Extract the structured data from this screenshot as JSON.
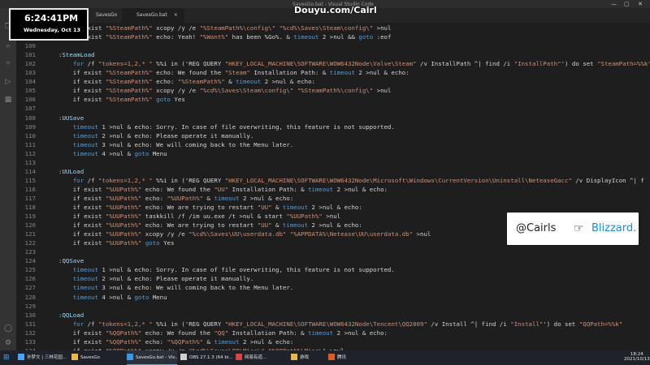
{
  "window": {
    "title": "SavesGo.bat - Visual Studio Code",
    "controls": [
      "—",
      "▢",
      "✕"
    ]
  },
  "tabs": [
    {
      "label": "SavesGo",
      "active": false
    },
    {
      "label": "SavesGo.bat",
      "active": true
    }
  ],
  "clock": {
    "time": "6:24:41PM",
    "date": "Wednesday, Oct 13"
  },
  "watermark": "Douyu.com/Cairl",
  "popup": {
    "handle": "@Cairls",
    "hand_icon": "pointing-hand-icon",
    "brand": "Blizzard."
  },
  "activity_bar": [
    "files-icon",
    "search-icon",
    "source-control-icon",
    "run-icon",
    "extensions-icon",
    "account-icon",
    "settings-icon"
  ],
  "code_lines": [
    {
      "num": "",
      "segments": [
        {
          "t": "plain",
          "s": "    if exist "
        },
        {
          "t": "str",
          "s": "\"%SteamPath%\""
        },
        {
          "t": "plain",
          "s": " xcopy /y /e "
        },
        {
          "t": "str",
          "s": "\"%SteamPath%\\config\\\""
        },
        {
          "t": "plain",
          "s": " "
        },
        {
          "t": "str",
          "s": "\"%cd%\\Saves\\Steam\\config\\\""
        },
        {
          "t": "plain",
          "s": " >nul"
        }
      ]
    },
    {
      "num": "",
      "segments": [
        {
          "t": "plain",
          "s": "    if exist "
        },
        {
          "t": "str",
          "s": "\"%SteamPath%\""
        },
        {
          "t": "plain",
          "s": " echo: Yeah! "
        },
        {
          "t": "str",
          "s": "\"%Want%\""
        },
        {
          "t": "plain",
          "s": " has been %Go%. & "
        },
        {
          "t": "kw",
          "s": "timeout"
        },
        {
          "t": "plain",
          "s": " 2 >nul && "
        },
        {
          "t": "kw",
          "s": "goto"
        },
        {
          "t": "plain",
          "s": " :eof"
        }
      ]
    },
    {
      "num": "100",
      "segments": []
    },
    {
      "num": "101",
      "segments": [
        {
          "t": "lbl",
          "s": ":SteamLoad"
        }
      ]
    },
    {
      "num": "102",
      "segments": [
        {
          "t": "plain",
          "s": "    "
        },
        {
          "t": "kw",
          "s": "for"
        },
        {
          "t": "plain",
          "s": " /f "
        },
        {
          "t": "str",
          "s": "\"tokens=1,2,* \""
        },
        {
          "t": "plain",
          "s": " %%i in ('REG QUERY "
        },
        {
          "t": "str",
          "s": "\"HKEY_LOCAL_MACHINE\\SOFTWARE\\WOW6432Node\\Valve\\Steam\""
        },
        {
          "t": "plain",
          "s": " /v InstallPath ^| find /i "
        },
        {
          "t": "str",
          "s": "\"InstallPath\""
        },
        {
          "t": "plain",
          "s": "') do set "
        },
        {
          "t": "str",
          "s": "\"SteamPath=%%k\""
        }
      ]
    },
    {
      "num": "103",
      "segments": [
        {
          "t": "plain",
          "s": "    if exist "
        },
        {
          "t": "str",
          "s": "\"%SteamPath%\""
        },
        {
          "t": "plain",
          "s": " echo: We found the "
        },
        {
          "t": "str",
          "s": "\"Steam\""
        },
        {
          "t": "plain",
          "s": " Installation Path: & "
        },
        {
          "t": "kw",
          "s": "timeout"
        },
        {
          "t": "plain",
          "s": " 2 >nul & echo:"
        }
      ]
    },
    {
      "num": "104",
      "segments": [
        {
          "t": "plain",
          "s": "    if exist "
        },
        {
          "t": "str",
          "s": "\"%SteamPath%\""
        },
        {
          "t": "plain",
          "s": " echo: "
        },
        {
          "t": "str",
          "s": "\"%SteamPath%\""
        },
        {
          "t": "plain",
          "s": " & "
        },
        {
          "t": "kw",
          "s": "timeout"
        },
        {
          "t": "plain",
          "s": " 2 >nul & echo:"
        }
      ]
    },
    {
      "num": "105",
      "segments": [
        {
          "t": "plain",
          "s": "    if exist "
        },
        {
          "t": "str",
          "s": "\"%SteamPath%\""
        },
        {
          "t": "plain",
          "s": " xcopy /y /e "
        },
        {
          "t": "str",
          "s": "\"%cd%\\Saves\\Steam\\config\\\""
        },
        {
          "t": "plain",
          "s": " "
        },
        {
          "t": "str",
          "s": "\"%SteamPath%\\config\\\""
        },
        {
          "t": "plain",
          "s": " >nul"
        }
      ]
    },
    {
      "num": "106",
      "segments": [
        {
          "t": "plain",
          "s": "    if exist "
        },
        {
          "t": "str",
          "s": "\"%SteamPath%\""
        },
        {
          "t": "plain",
          "s": " "
        },
        {
          "t": "kw",
          "s": "goto"
        },
        {
          "t": "plain",
          "s": " Yes"
        }
      ]
    },
    {
      "num": "107",
      "segments": []
    },
    {
      "num": "108",
      "segments": [
        {
          "t": "lbl",
          "s": ":UUSave"
        }
      ]
    },
    {
      "num": "109",
      "segments": [
        {
          "t": "plain",
          "s": "    "
        },
        {
          "t": "kw",
          "s": "timeout"
        },
        {
          "t": "plain",
          "s": " 1 >nul & echo: Sorry. In case of file overwriting, this feature is not supported."
        }
      ]
    },
    {
      "num": "110",
      "segments": [
        {
          "t": "plain",
          "s": "    "
        },
        {
          "t": "kw",
          "s": "timeout"
        },
        {
          "t": "plain",
          "s": " 2 >nul & echo: Please operate it manually."
        }
      ]
    },
    {
      "num": "111",
      "segments": [
        {
          "t": "plain",
          "s": "    "
        },
        {
          "t": "kw",
          "s": "timeout"
        },
        {
          "t": "plain",
          "s": " 3 >nul & echo: We will coming back to the Menu later."
        }
      ]
    },
    {
      "num": "112",
      "segments": [
        {
          "t": "plain",
          "s": "    "
        },
        {
          "t": "kw",
          "s": "timeout"
        },
        {
          "t": "plain",
          "s": " 4 >nul & "
        },
        {
          "t": "kw",
          "s": "goto"
        },
        {
          "t": "plain",
          "s": " Menu"
        }
      ]
    },
    {
      "num": "113",
      "segments": []
    },
    {
      "num": "114",
      "segments": [
        {
          "t": "lbl",
          "s": ":UULoad"
        }
      ]
    },
    {
      "num": "115",
      "segments": [
        {
          "t": "plain",
          "s": "    "
        },
        {
          "t": "kw",
          "s": "for"
        },
        {
          "t": "plain",
          "s": " /f "
        },
        {
          "t": "str",
          "s": "\"tokens=1,2,* \""
        },
        {
          "t": "plain",
          "s": " %%i in ('REG QUERY "
        },
        {
          "t": "str",
          "s": "\"HKEY_LOCAL_MACHINE\\SOFTWARE\\WOW6432Node\\Microsoft\\Windows\\CurrentVersion\\Uninstall\\NeteaseGacc\""
        },
        {
          "t": "plain",
          "s": " /v DisplayIcon ^| f"
        }
      ]
    },
    {
      "num": "116",
      "segments": [
        {
          "t": "plain",
          "s": "    if exist "
        },
        {
          "t": "str",
          "s": "\"%UUPath%\""
        },
        {
          "t": "plain",
          "s": " echo: We found the "
        },
        {
          "t": "str",
          "s": "\"UU\""
        },
        {
          "t": "plain",
          "s": " Installation Path: & "
        },
        {
          "t": "kw",
          "s": "timeout"
        },
        {
          "t": "plain",
          "s": " 2 >nul & echo:"
        }
      ]
    },
    {
      "num": "117",
      "segments": [
        {
          "t": "plain",
          "s": "    if exist "
        },
        {
          "t": "str",
          "s": "\"%UUPath%\""
        },
        {
          "t": "plain",
          "s": " echo: "
        },
        {
          "t": "str",
          "s": "\"%UUPath%\""
        },
        {
          "t": "plain",
          "s": " & "
        },
        {
          "t": "kw",
          "s": "timeout"
        },
        {
          "t": "plain",
          "s": " 2 >nul & echo:"
        }
      ]
    },
    {
      "num": "118",
      "segments": [
        {
          "t": "plain",
          "s": "    if exist "
        },
        {
          "t": "str",
          "s": "\"%UUPath%\""
        },
        {
          "t": "plain",
          "s": " echo: We are trying to restart "
        },
        {
          "t": "str",
          "s": "\"UU\""
        },
        {
          "t": "plain",
          "s": " & "
        },
        {
          "t": "kw",
          "s": "timeout"
        },
        {
          "t": "plain",
          "s": " 2 >nul & echo:"
        }
      ]
    },
    {
      "num": "119",
      "segments": [
        {
          "t": "plain",
          "s": "    if exist "
        },
        {
          "t": "str",
          "s": "\"%UUPath%\""
        },
        {
          "t": "plain",
          "s": " taskkill /f /im uu.exe /t >nul & start "
        },
        {
          "t": "str",
          "s": "\"%UUPath%\""
        },
        {
          "t": "plain",
          "s": " >nul"
        }
      ]
    },
    {
      "num": "120",
      "segments": [
        {
          "t": "plain",
          "s": "    if exist "
        },
        {
          "t": "str",
          "s": "\"%UUPath%\""
        },
        {
          "t": "plain",
          "s": " echo: We are trying to restart "
        },
        {
          "t": "str",
          "s": "\"UU\""
        },
        {
          "t": "plain",
          "s": " & "
        },
        {
          "t": "kw",
          "s": "timeout"
        },
        {
          "t": "plain",
          "s": " 2 >nul & echo:"
        }
      ]
    },
    {
      "num": "121",
      "segments": [
        {
          "t": "plain",
          "s": "    if exist "
        },
        {
          "t": "str",
          "s": "\"%UUPath%\""
        },
        {
          "t": "plain",
          "s": " xcopy /y /e "
        },
        {
          "t": "str",
          "s": "\"%cd%\\Saves\\UU\\userdata.db\""
        },
        {
          "t": "plain",
          "s": " "
        },
        {
          "t": "str",
          "s": "\"%APPDATA%\\Netease\\UU\\userdata.db\""
        },
        {
          "t": "plain",
          "s": " >nul"
        }
      ]
    },
    {
      "num": "122",
      "segments": [
        {
          "t": "plain",
          "s": "    if exist "
        },
        {
          "t": "str",
          "s": "\"%UUPath%\""
        },
        {
          "t": "plain",
          "s": " "
        },
        {
          "t": "kw",
          "s": "goto"
        },
        {
          "t": "plain",
          "s": " Yes"
        }
      ]
    },
    {
      "num": "123",
      "segments": []
    },
    {
      "num": "124",
      "segments": [
        {
          "t": "lbl",
          "s": ":QQSave"
        }
      ]
    },
    {
      "num": "125",
      "segments": [
        {
          "t": "plain",
          "s": "    "
        },
        {
          "t": "kw",
          "s": "timeout"
        },
        {
          "t": "plain",
          "s": " 1 >nul & echo: Sorry. In case of file overwriting, this feature is not supported."
        }
      ]
    },
    {
      "num": "126",
      "segments": [
        {
          "t": "plain",
          "s": "    "
        },
        {
          "t": "kw",
          "s": "timeout"
        },
        {
          "t": "plain",
          "s": " 2 >nul & echo: Please operate it manually."
        }
      ]
    },
    {
      "num": "127",
      "segments": [
        {
          "t": "plain",
          "s": "    "
        },
        {
          "t": "kw",
          "s": "timeout"
        },
        {
          "t": "plain",
          "s": " 3 >nul & echo: We will coming back to the Menu later."
        }
      ]
    },
    {
      "num": "128",
      "segments": [
        {
          "t": "plain",
          "s": "    "
        },
        {
          "t": "kw",
          "s": "timeout"
        },
        {
          "t": "plain",
          "s": " 4 >nul & "
        },
        {
          "t": "kw",
          "s": "goto"
        },
        {
          "t": "plain",
          "s": " Menu"
        }
      ]
    },
    {
      "num": "129",
      "segments": []
    },
    {
      "num": "130",
      "segments": [
        {
          "t": "lbl",
          "s": ":QQLoad"
        }
      ]
    },
    {
      "num": "131",
      "segments": [
        {
          "t": "plain",
          "s": "    "
        },
        {
          "t": "kw",
          "s": "for"
        },
        {
          "t": "plain",
          "s": " /f "
        },
        {
          "t": "str",
          "s": "\"tokens=1,2,* \""
        },
        {
          "t": "plain",
          "s": " %%i in ('REG QUERY "
        },
        {
          "t": "str",
          "s": "\"HKEY_LOCAL_MACHINE\\SOFTWARE\\WOW6432Node\\Tencent\\QQ2009\""
        },
        {
          "t": "plain",
          "s": " /v Install ^| find /i "
        },
        {
          "t": "str",
          "s": "\"Install\""
        },
        {
          "t": "plain",
          "s": "') do set "
        },
        {
          "t": "str",
          "s": "\"QQPath=%%k\""
        }
      ]
    },
    {
      "num": "132",
      "segments": [
        {
          "t": "plain",
          "s": "    if exist "
        },
        {
          "t": "str",
          "s": "\"%QQPath%\""
        },
        {
          "t": "plain",
          "s": " echo: We found the "
        },
        {
          "t": "str",
          "s": "\"QQ\""
        },
        {
          "t": "plain",
          "s": " Installation Path: & "
        },
        {
          "t": "kw",
          "s": "timeout"
        },
        {
          "t": "plain",
          "s": " 2 >nul & echo:"
        }
      ]
    },
    {
      "num": "133",
      "segments": [
        {
          "t": "plain",
          "s": "    if exist "
        },
        {
          "t": "str",
          "s": "\"%QQPath%\""
        },
        {
          "t": "plain",
          "s": " echo: "
        },
        {
          "t": "str",
          "s": "\"%QQPath%\""
        },
        {
          "t": "plain",
          "s": " & "
        },
        {
          "t": "kw",
          "s": "timeout"
        },
        {
          "t": "plain",
          "s": " 2 >nul & echo:"
        }
      ]
    },
    {
      "num": "134",
      "segments": [
        {
          "t": "plain",
          "s": "    if exist "
        },
        {
          "t": "str",
          "s": "\"%QQPath%\""
        },
        {
          "t": "plain",
          "s": " xcopy /y /e "
        },
        {
          "t": "str",
          "s": "\"%cd%\\Saves\\QQ\\Misc\\\""
        },
        {
          "t": "plain",
          "s": " "
        },
        {
          "t": "str",
          "s": "\"%QQPath%\\Misc\\\""
        },
        {
          "t": "plain",
          "s": " >nul"
        }
      ]
    }
  ],
  "taskbar": {
    "items": [
      {
        "label": "孙梦文 | 三林花园...",
        "icon_color": "#4aa3ff",
        "active": false
      },
      {
        "label": "SavesGo",
        "icon_color": "#e8b84a",
        "active": false
      },
      {
        "label": "SavesGo.bat - Vis...",
        "icon_color": "#3a96dd",
        "active": true
      },
      {
        "label": "OBS 27.1.3 (64 bi...",
        "icon_color": "#cfcfcf",
        "active": false
      },
      {
        "label": "网易有道...",
        "icon_color": "#d64545",
        "active": false
      },
      {
        "label": "游戏",
        "icon_color": "#e8b84a",
        "active": false
      },
      {
        "label": "腾讯",
        "icon_color": "#e05a2a",
        "active": false
      }
    ],
    "time": "18:24",
    "date": "2021/10/13"
  }
}
